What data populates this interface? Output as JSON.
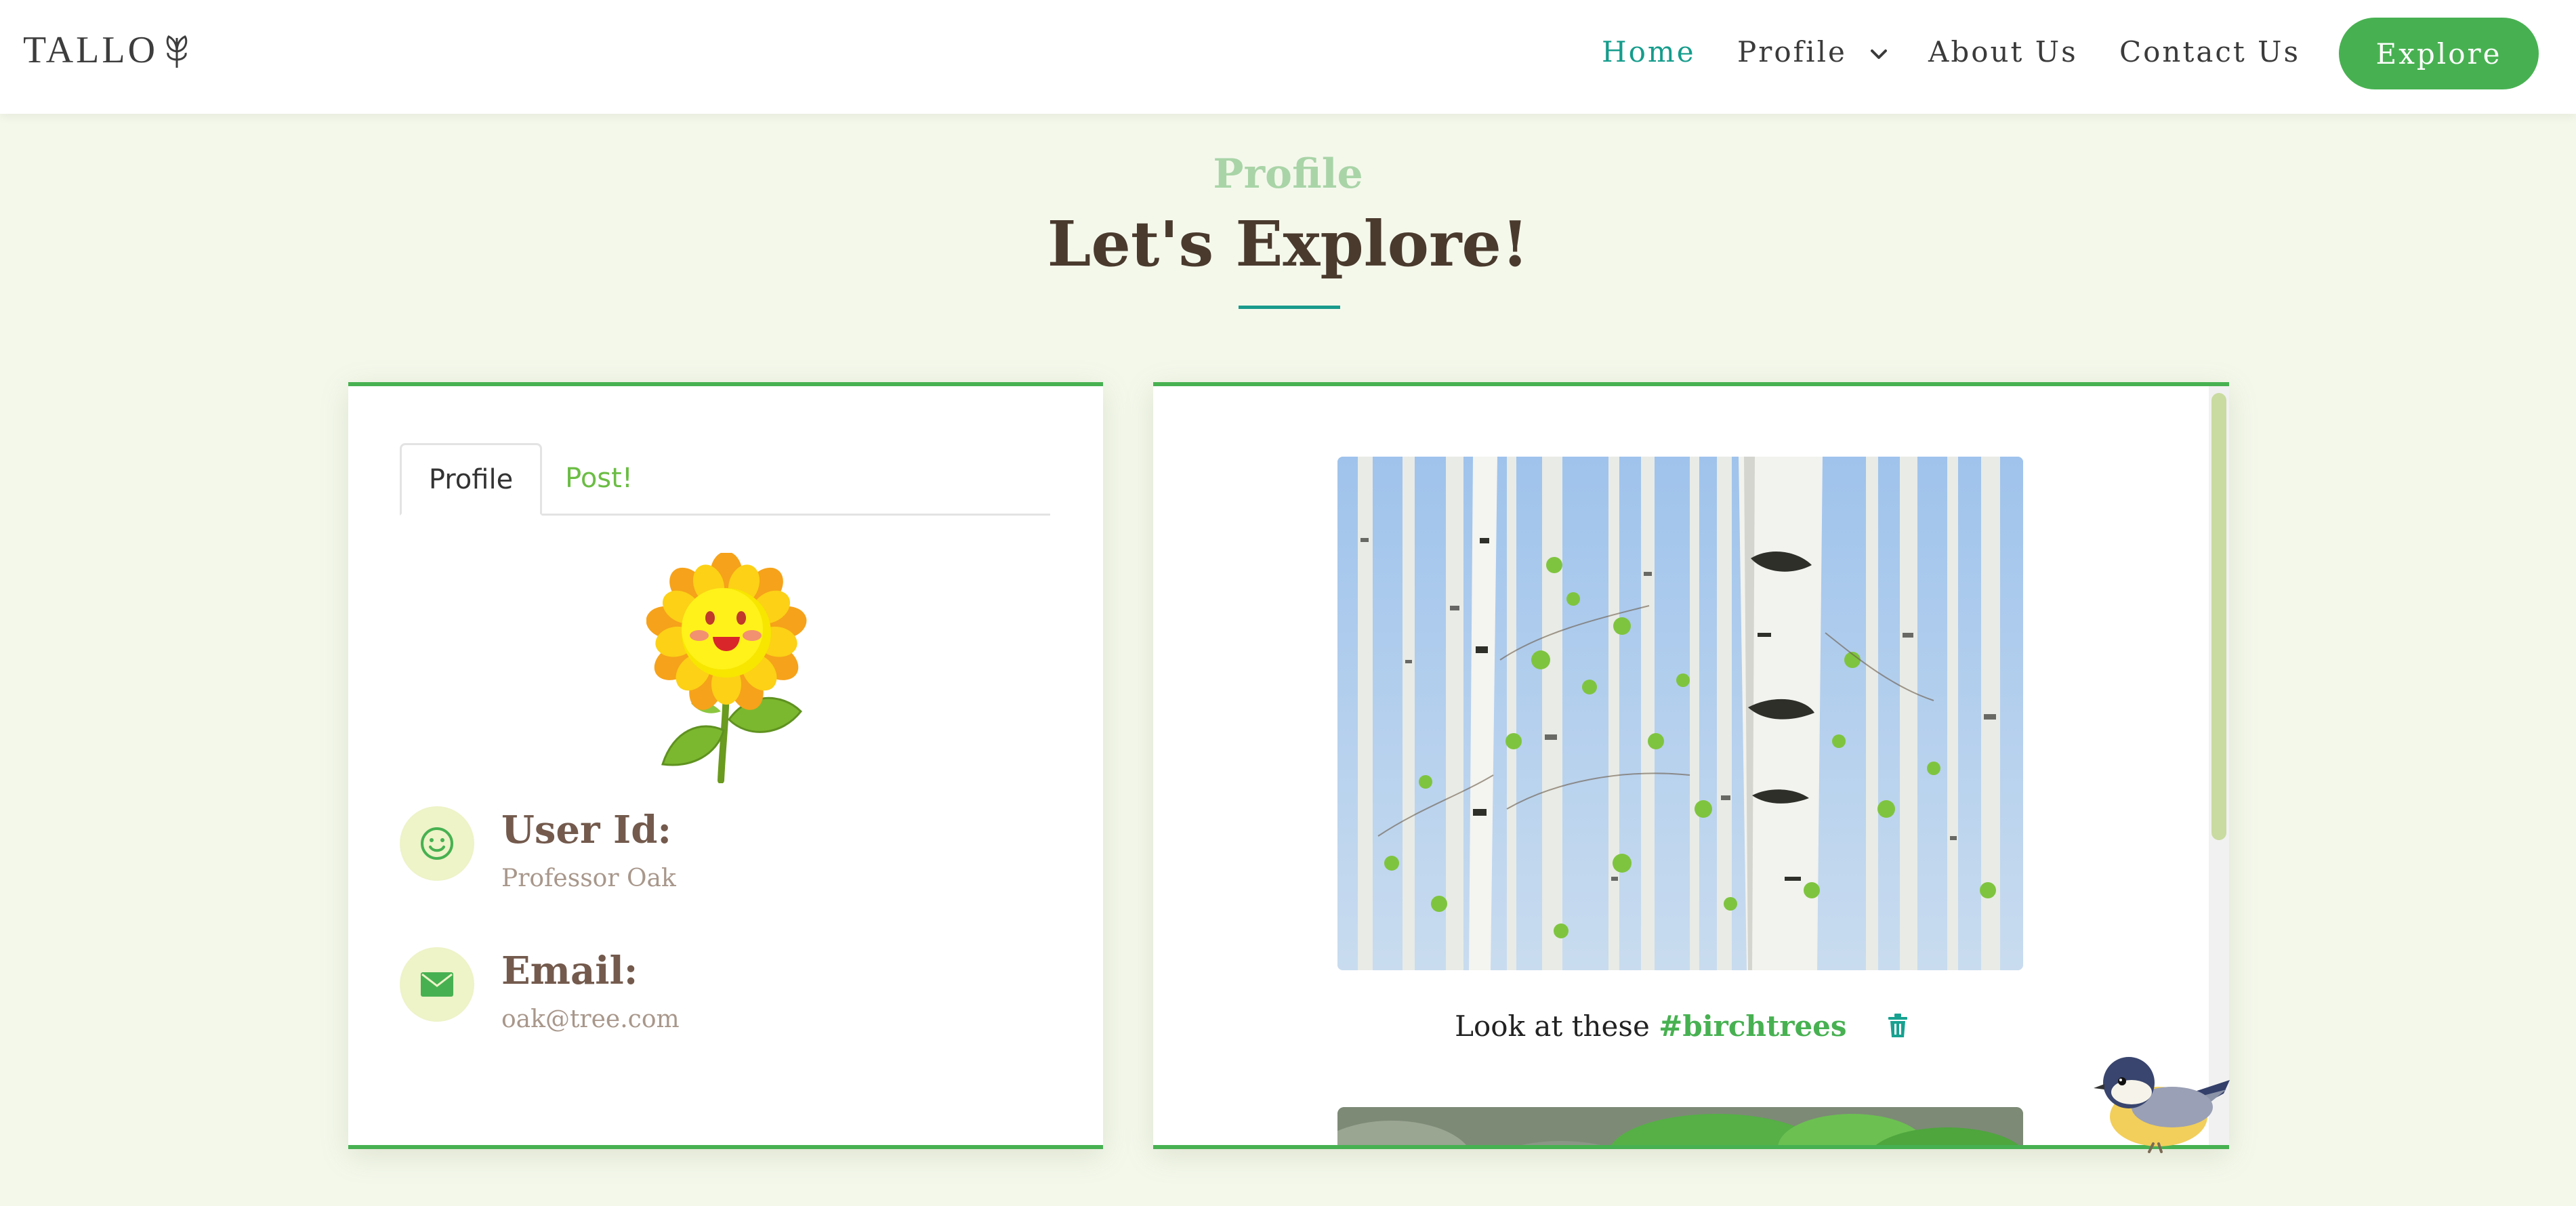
{
  "header": {
    "logo_text": "TALLO",
    "logo_icon": "leaf-icon",
    "nav": [
      {
        "label": "Home",
        "active": true
      },
      {
        "label": "Profile",
        "has_dropdown": true
      },
      {
        "label": "About Us"
      },
      {
        "label": "Contact Us"
      }
    ],
    "cta_label": "Explore"
  },
  "section": {
    "subtitle": "Profile",
    "title": "Let's Explore!"
  },
  "profile_card": {
    "tabs": [
      {
        "label": "Profile",
        "active": true
      },
      {
        "label": "Post!"
      }
    ],
    "avatar": "sunflower-avatar",
    "user_id_label": "User Id:",
    "user_id_value": "Professor Oak",
    "email_label": "Email:",
    "email_value": "oak@tree.com"
  },
  "feed": {
    "posts": [
      {
        "image": "birch-trees-photo",
        "caption_prefix": "Look at these",
        "hashtag": "#birchtrees"
      },
      {
        "image": "green-leaves-photo"
      }
    ]
  },
  "colors": {
    "accent_green": "#47b151",
    "teal": "#159c8c",
    "page_bg": "#f4f8eb",
    "title_brown": "#4a3a2e"
  }
}
